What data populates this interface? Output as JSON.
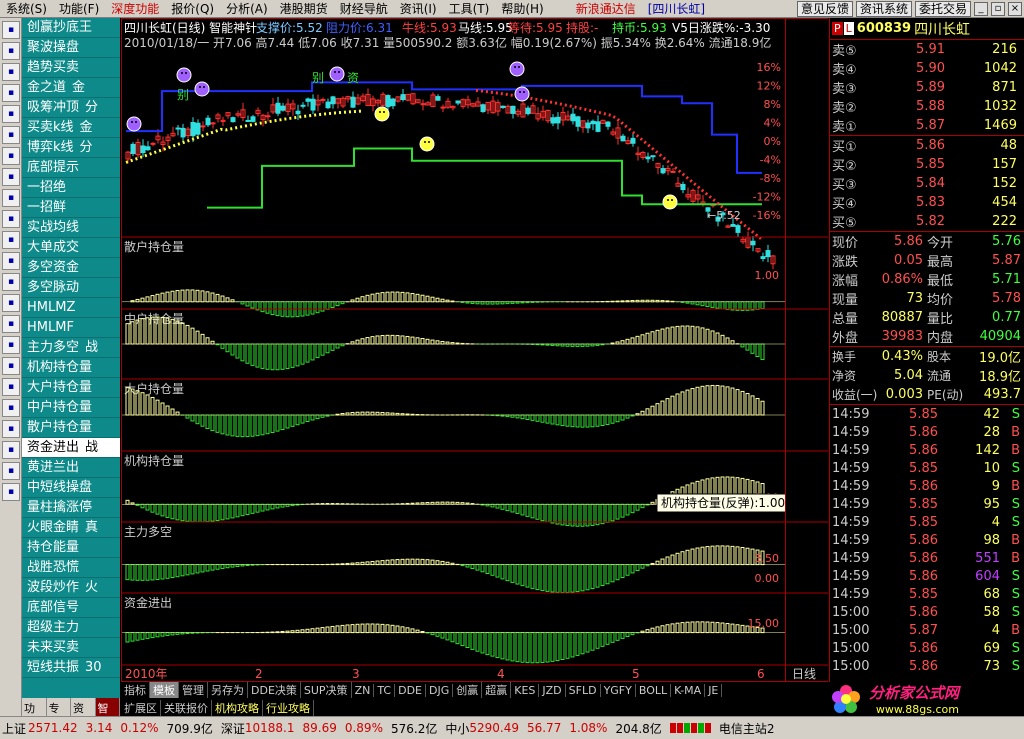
{
  "menu": {
    "items": [
      "系统(S)",
      "功能(F)",
      "深度功能",
      "报价(Q)",
      "分析(A)",
      "港股期货",
      "财经导航",
      "资讯(I)",
      "工具(T)",
      "帮助(H)"
    ],
    "news": "新浪通达信",
    "stock_tag": "[四川长虹]",
    "buttons": [
      "意见反馈",
      "资讯系统",
      "委托交易"
    ]
  },
  "formulas": {
    "items": [
      "创赢抄底王",
      "聚波操盘",
      "趋势买卖",
      "金之道",
      "吸筹冲顶",
      "买卖k线",
      "博弈k线",
      "底部提示",
      "一招绝",
      "一招鲜",
      "实战均线",
      "大单成交",
      "多空资金",
      "多空脉动",
      "HMLMZ",
      "HMLMF",
      "主力多空",
      "机构持仓量",
      "大户持仓量",
      "中户持仓量",
      "散户持仓量",
      "资金进出",
      "黄进兰出",
      "中短线操盘",
      "量柱擒涨停",
      "火眼金睛",
      "持仓能量",
      "战胜恐慌",
      "波段炒作",
      "底部信号",
      "超级主力",
      "未来买卖",
      "短线共振"
    ],
    "suffixes": [
      "",
      "",
      "",
      "金",
      "分",
      "金",
      "分",
      "",
      "",
      "",
      "",
      "",
      "",
      "",
      "",
      "",
      "战",
      "",
      "",
      "",
      "",
      "战",
      "",
      "",
      "",
      "真",
      "",
      "",
      "火",
      "",
      "",
      "",
      "30"
    ],
    "selected_index": 21
  },
  "left_tabs": [
    "功能",
    "专评",
    "资讯",
    "智能"
  ],
  "chart": {
    "main_header": "四川长虹(日线) 智能神针",
    "indicators": [
      {
        "text": "支撑价:5.52",
        "color": "#7ec8ff"
      },
      {
        "text": "阻力价:6.31",
        "color": "#4060ff"
      },
      {
        "text": "牛线:5.93",
        "color": "#ff4040"
      },
      {
        "text": "马线:5.95",
        "color": "#ffffff"
      },
      {
        "text": "等待:5.95",
        "color": "#ff4040"
      },
      {
        "text": "持股:-",
        "color": "#ff4040"
      },
      {
        "text": "持币:5.93",
        "color": "#40ff40"
      },
      {
        "text": "V5日涨跌%:-3.30",
        "color": "#ffffff"
      }
    ],
    "date_line": "2010/01/18/一 开7.06 高7.44 低7.06 收7.31 量500590.2 额3.63亿 幅0.19(2.67%) 振5.34% 换2.64% 流通18.9亿",
    "main_tags": [
      "别",
      "别",
      "资"
    ],
    "low_label": "←5.52",
    "pct_ticks": [
      "16%",
      "12%",
      "8%",
      "4%",
      "0%",
      "-4%",
      "-8%",
      "-12%",
      "-16%"
    ],
    "sub_panels": [
      {
        "title": "散户持仓量",
        "ticks": [
          "1.00"
        ]
      },
      {
        "title": "中户持仓量",
        "ticks": []
      },
      {
        "title": "大户持仓量",
        "ticks": []
      },
      {
        "title": "机构持仓量",
        "ticks": [
          "1.00"
        ]
      },
      {
        "title": "主力多空",
        "ticks": [
          "3.50",
          "0.00"
        ]
      },
      {
        "title": "资金进出",
        "ticks": [
          "15.00"
        ]
      }
    ],
    "tooltip": "机构持仓量(反弹):1.00",
    "x_labels": [
      "2010年",
      "2",
      "3",
      "4",
      "5",
      "6"
    ],
    "period": "日线"
  },
  "bottom_tabs_1": [
    "指标",
    "模板",
    "管理",
    "另存为",
    "DDE决策",
    "SUP决策",
    "ZN",
    "TC",
    "DDE",
    "DJG",
    "创赢",
    "超赢",
    "KES",
    "JZD",
    "SFLD",
    "YGFY",
    "BOLL",
    "K-MA",
    "JE"
  ],
  "bottom_tabs_2": [
    "扩展区",
    "关联报价",
    "机构攻略",
    "行业攻略"
  ],
  "quote": {
    "code": "600839",
    "name": "四川长虹",
    "asks": [
      {
        "label": "卖⑤",
        "price": "5.91",
        "vol": "216"
      },
      {
        "label": "卖④",
        "price": "5.90",
        "vol": "1042"
      },
      {
        "label": "卖③",
        "price": "5.89",
        "vol": "871"
      },
      {
        "label": "卖②",
        "price": "5.88",
        "vol": "1032"
      },
      {
        "label": "卖①",
        "price": "5.87",
        "vol": "1469"
      }
    ],
    "bids": [
      {
        "label": "买①",
        "price": "5.86",
        "vol": "48"
      },
      {
        "label": "买②",
        "price": "5.85",
        "vol": "157"
      },
      {
        "label": "买③",
        "price": "5.84",
        "vol": "152"
      },
      {
        "label": "买④",
        "price": "5.83",
        "vol": "454"
      },
      {
        "label": "买⑤",
        "price": "5.82",
        "vol": "222"
      }
    ],
    "stats": [
      {
        "l1": "现价",
        "v1": "5.86",
        "c1": "#ff5050",
        "l2": "今开",
        "v2": "5.76",
        "c2": "#40ff40"
      },
      {
        "l1": "涨跌",
        "v1": "0.05",
        "c1": "#ff5050",
        "l2": "最高",
        "v2": "5.87",
        "c2": "#ff5050"
      },
      {
        "l1": "涨幅",
        "v1": "0.86%",
        "c1": "#ff5050",
        "l2": "最低",
        "v2": "5.71",
        "c2": "#40ff40"
      },
      {
        "l1": "现量",
        "v1": "73",
        "c1": "#ffff60",
        "l2": "均价",
        "v2": "5.78",
        "c2": "#ff5050"
      },
      {
        "l1": "总量",
        "v1": "80887",
        "c1": "#ffff60",
        "l2": "量比",
        "v2": "0.77",
        "c2": "#40ff40"
      },
      {
        "l1": "外盘",
        "v1": "39983",
        "c1": "#ff5050",
        "l2": "内盘",
        "v2": "40904",
        "c2": "#40ff40"
      }
    ],
    "stats2": [
      {
        "l1": "换手",
        "v1": "0.43%",
        "l2": "股本",
        "v2": "19.0亿"
      },
      {
        "l1": "净资",
        "v1": "5.04",
        "l2": "流通",
        "v2": "18.9亿"
      },
      {
        "l1": "收益(一)",
        "v1": "0.003",
        "l2": "PE(动)",
        "v2": "493.7"
      }
    ],
    "ticks": [
      {
        "t": "14:59",
        "p": "5.85",
        "v": "42",
        "d": "S",
        "vc": "#ffff60"
      },
      {
        "t": "14:59",
        "p": "5.86",
        "v": "28",
        "d": "B",
        "vc": "#ffff60"
      },
      {
        "t": "14:59",
        "p": "5.86",
        "v": "142",
        "d": "B",
        "vc": "#ffff60"
      },
      {
        "t": "14:59",
        "p": "5.85",
        "v": "10",
        "d": "S",
        "vc": "#ffff60"
      },
      {
        "t": "14:59",
        "p": "5.86",
        "v": "9",
        "d": "B",
        "vc": "#ffff60"
      },
      {
        "t": "14:59",
        "p": "5.85",
        "v": "95",
        "d": "S",
        "vc": "#ffff60"
      },
      {
        "t": "14:59",
        "p": "5.85",
        "v": "4",
        "d": "S",
        "vc": "#ffff60"
      },
      {
        "t": "14:59",
        "p": "5.86",
        "v": "98",
        "d": "B",
        "vc": "#ffff60"
      },
      {
        "t": "14:59",
        "p": "5.86",
        "v": "551",
        "d": "B",
        "vc": "#c040ff"
      },
      {
        "t": "14:59",
        "p": "5.86",
        "v": "604",
        "d": "S",
        "vc": "#c040ff"
      },
      {
        "t": "14:59",
        "p": "5.85",
        "v": "68",
        "d": "S",
        "vc": "#ffff60"
      },
      {
        "t": "15:00",
        "p": "5.86",
        "v": "58",
        "d": "S",
        "vc": "#ffff60"
      },
      {
        "t": "15:00",
        "p": "5.87",
        "v": "4",
        "d": "B",
        "vc": "#ffff60"
      },
      {
        "t": "15:00",
        "p": "5.86",
        "v": "69",
        "d": "S",
        "vc": "#ffff60"
      },
      {
        "t": "15:00",
        "p": "5.86",
        "v": "73",
        "d": "S",
        "vc": "#ffff60"
      }
    ]
  },
  "logo": {
    "text": "分析家公式网",
    "url": "www.88gs.com"
  },
  "status": {
    "sh_label": "上证",
    "sh_val": "2571.42",
    "sh_chg": "3.14",
    "sh_pct": "0.12%",
    "sh_amt": "709.9亿",
    "sz_label": "深证",
    "sz_val": "10188.1",
    "sz_chg": "89.69",
    "sz_pct": "0.89%",
    "sz_amt": "576.2亿",
    "zx_label": "中小",
    "zx_val": "5290.49",
    "zx_chg": "56.77",
    "zx_pct": "1.08%",
    "zx_amt": "204.8亿",
    "server": "电信主站2"
  }
}
